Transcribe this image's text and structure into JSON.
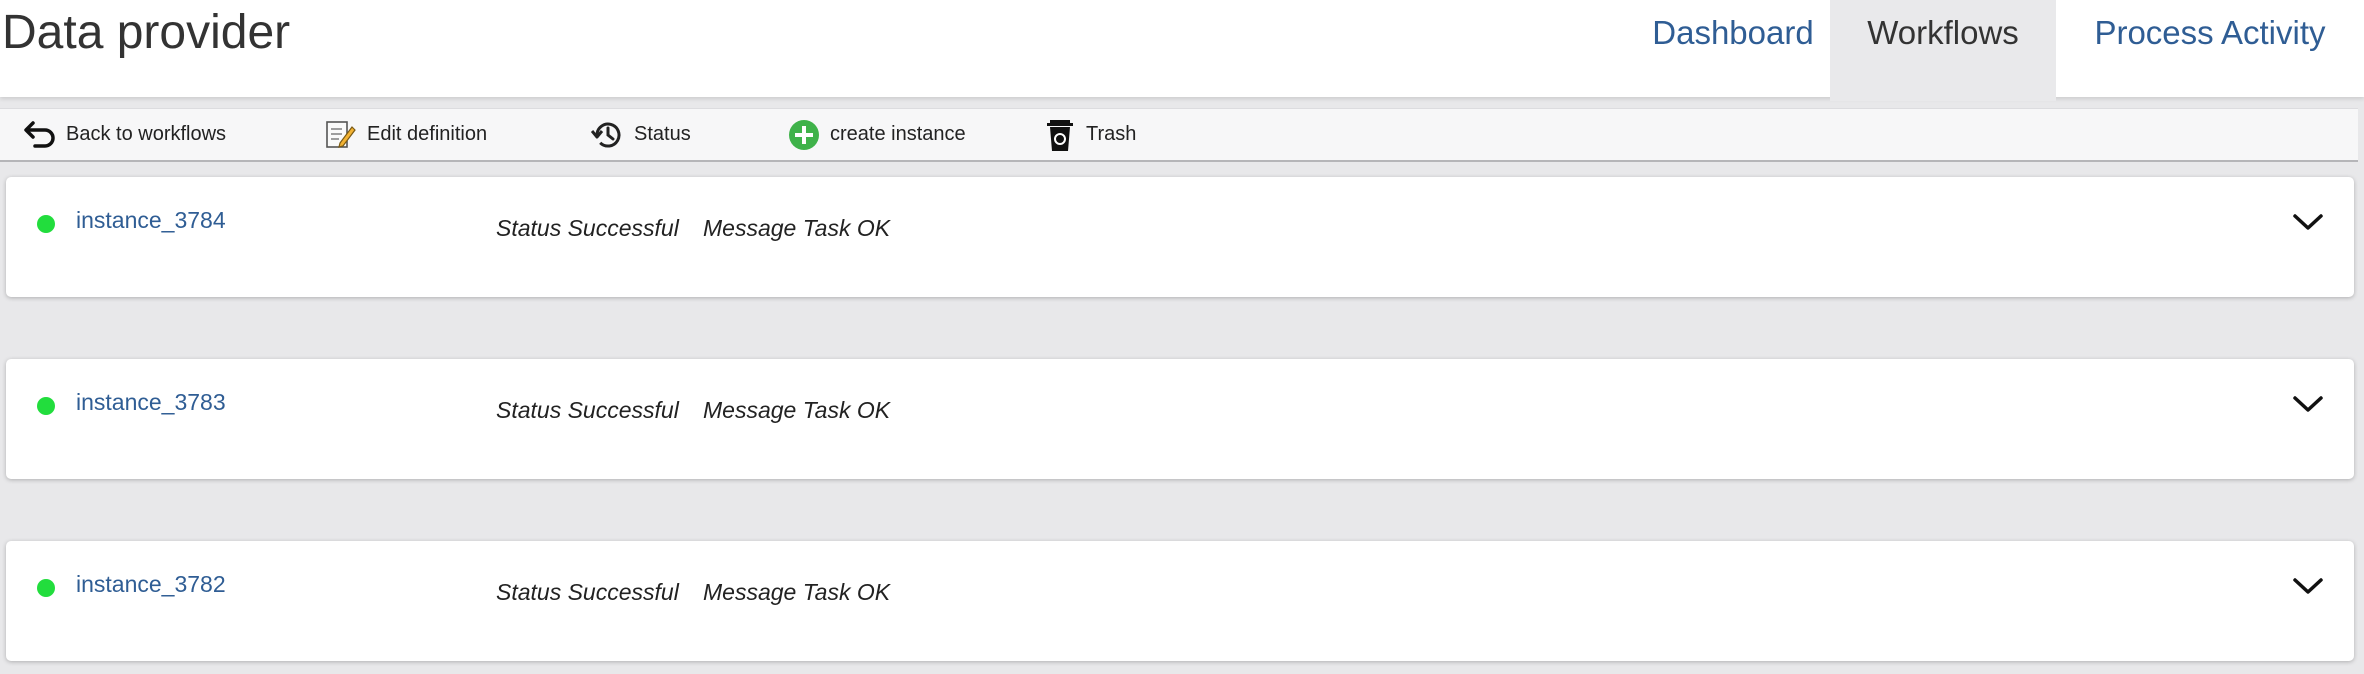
{
  "header": {
    "title": "Data provider",
    "tabs": [
      {
        "label": "Dashboard"
      },
      {
        "label": "Workflows"
      },
      {
        "label": "Process Activity"
      }
    ]
  },
  "toolbar": {
    "back_label": "Back to workflows",
    "edit_label": "Edit definition",
    "status_label": "Status",
    "create_label": "create instance",
    "trash_label": "Trash",
    "icons": {
      "back": "back-arrow-icon",
      "edit": "edit-document-icon",
      "status": "history-clock-icon",
      "create": "plus-circle-icon",
      "trash": "trash-can-icon"
    }
  },
  "instances": [
    {
      "name": "instance_3784",
      "status": "Status Successful",
      "message": "Message Task OK"
    },
    {
      "name": "instance_3783",
      "status": "Status Successful",
      "message": "Message Task OK"
    },
    {
      "name": "instance_3782",
      "status": "Status Successful",
      "message": "Message Task OK"
    }
  ],
  "colors": {
    "link": "#2f5d94",
    "status_ok": "#22dd3d",
    "create_green": "#3fb24a"
  }
}
